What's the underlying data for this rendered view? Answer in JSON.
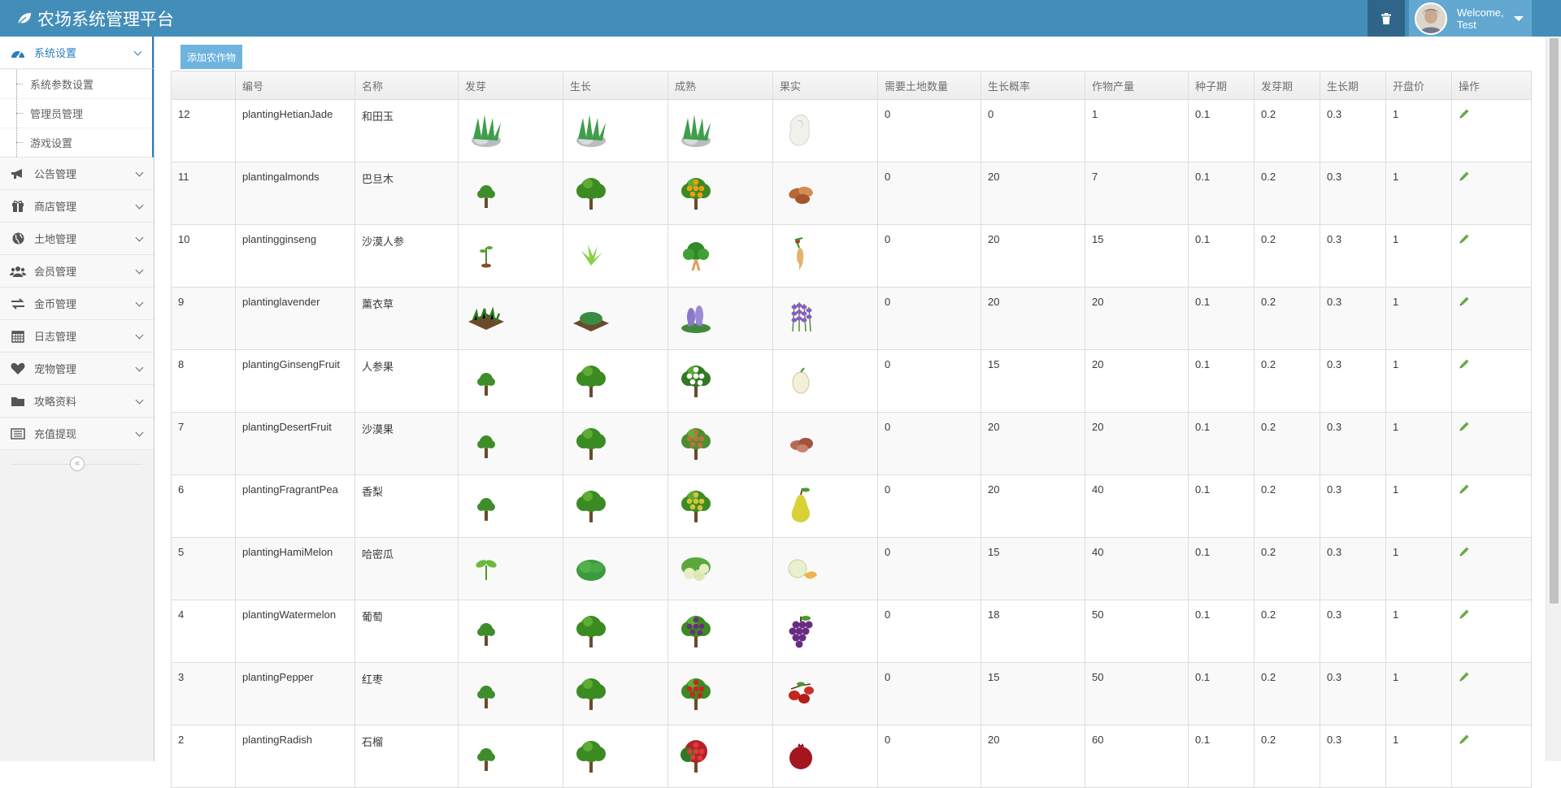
{
  "app": {
    "title": "农场系统管理平台"
  },
  "user": {
    "welcome": "Welcome,",
    "name": "Test"
  },
  "sidebar": {
    "active": {
      "label": "系统设置",
      "children": [
        "系统参数设置",
        "管理员管理",
        "游戏设置"
      ]
    },
    "items": [
      {
        "label": "公告管理",
        "icon": "bullhorn-icon"
      },
      {
        "label": "商店管理",
        "icon": "gift-icon"
      },
      {
        "label": "土地管理",
        "icon": "globe-icon"
      },
      {
        "label": "会员管理",
        "icon": "users-icon"
      },
      {
        "label": "金币管理",
        "icon": "exchange-icon"
      },
      {
        "label": "日志管理",
        "icon": "calendar-icon"
      },
      {
        "label": "宠物管理",
        "icon": "heart-icon"
      },
      {
        "label": "攻略资料",
        "icon": "folder-icon"
      },
      {
        "label": "充值提现",
        "icon": "list-icon"
      }
    ],
    "collapse_label": "«"
  },
  "toolbar": {
    "add_label": "添加农作物"
  },
  "table": {
    "columns": [
      "",
      "编号",
      "名称",
      "发芽",
      "生长",
      "成熟",
      "果实",
      "需要土地数量",
      "生长概率",
      "作物产量",
      "种子期",
      "发芽期",
      "生长期",
      "开盘价",
      "操作"
    ],
    "rows": [
      {
        "id": "12",
        "code": "plantingHetianJade",
        "name": "和田玉",
        "sprout": "jade-grass",
        "grow": "jade-grass",
        "mature": "jade-grass",
        "fruit": "jade-stone",
        "land": "0",
        "rate": "0",
        "yield": "1",
        "seed": "0.1",
        "germ": "0.2",
        "growth": "0.3",
        "price": "1"
      },
      {
        "id": "11",
        "code": "plantingalmonds",
        "name": "巴旦木",
        "sprout": "sapling",
        "grow": "tree",
        "mature": "orange-tree",
        "fruit": "almonds",
        "land": "0",
        "rate": "20",
        "yield": "7",
        "seed": "0.1",
        "germ": "0.2",
        "growth": "0.3",
        "price": "1"
      },
      {
        "id": "10",
        "code": "plantingginseng",
        "name": "沙漠人参",
        "sprout": "seedling",
        "grow": "leafy",
        "mature": "ginseng-plant",
        "fruit": "ginseng-root",
        "land": "0",
        "rate": "20",
        "yield": "15",
        "seed": "0.1",
        "germ": "0.2",
        "growth": "0.3",
        "price": "1"
      },
      {
        "id": "9",
        "code": "plantinglavender",
        "name": "薰衣草",
        "sprout": "plot",
        "grow": "plot-green",
        "mature": "lavender-plant",
        "fruit": "lavender",
        "land": "0",
        "rate": "20",
        "yield": "20",
        "seed": "0.1",
        "germ": "0.2",
        "growth": "0.3",
        "price": "1"
      },
      {
        "id": "8",
        "code": "plantingGinsengFruit",
        "name": "人参果",
        "sprout": "sapling",
        "grow": "tree",
        "mature": "white-tree",
        "fruit": "ginseng-fruit",
        "land": "0",
        "rate": "15",
        "yield": "20",
        "seed": "0.1",
        "germ": "0.2",
        "growth": "0.3",
        "price": "1"
      },
      {
        "id": "7",
        "code": "plantingDesertFruit",
        "name": "沙漠果",
        "sprout": "sapling",
        "grow": "tree",
        "mature": "nut-tree",
        "fruit": "desert-fruit",
        "land": "0",
        "rate": "20",
        "yield": "20",
        "seed": "0.1",
        "germ": "0.2",
        "growth": "0.3",
        "price": "1"
      },
      {
        "id": "6",
        "code": "plantingFragrantPea",
        "name": "香梨",
        "sprout": "sapling",
        "grow": "tree",
        "mature": "pear-tree",
        "fruit": "pear",
        "land": "0",
        "rate": "20",
        "yield": "40",
        "seed": "0.1",
        "germ": "0.2",
        "growth": "0.3",
        "price": "1"
      },
      {
        "id": "5",
        "code": "plantingHamiMelon",
        "name": "哈密瓜",
        "sprout": "sprout",
        "grow": "bush",
        "mature": "melon-vine",
        "fruit": "melon",
        "land": "0",
        "rate": "15",
        "yield": "40",
        "seed": "0.1",
        "germ": "0.2",
        "growth": "0.3",
        "price": "1"
      },
      {
        "id": "4",
        "code": "plantingWatermelon",
        "name": "葡萄",
        "sprout": "sapling",
        "grow": "tree",
        "mature": "grape-tree",
        "fruit": "grapes",
        "land": "0",
        "rate": "18",
        "yield": "50",
        "seed": "0.1",
        "germ": "0.2",
        "growth": "0.3",
        "price": "1"
      },
      {
        "id": "3",
        "code": "plantingPepper",
        "name": "红枣",
        "sprout": "sapling",
        "grow": "tree",
        "mature": "date-tree",
        "fruit": "dates",
        "land": "0",
        "rate": "15",
        "yield": "50",
        "seed": "0.1",
        "germ": "0.2",
        "growth": "0.3",
        "price": "1"
      },
      {
        "id": "2",
        "code": "plantingRadish",
        "name": "石榴",
        "sprout": "sapling",
        "grow": "tree",
        "mature": "pomegranate-tree",
        "fruit": "pomegranate",
        "land": "0",
        "rate": "20",
        "yield": "60",
        "seed": "0.1",
        "germ": "0.2",
        "growth": "0.3",
        "price": "1"
      }
    ]
  },
  "colors": {
    "navbar": "#438eb9",
    "accent": "#2b7dbc",
    "add_button": "#6fb3e0",
    "edit_icon": "#69aa46"
  }
}
